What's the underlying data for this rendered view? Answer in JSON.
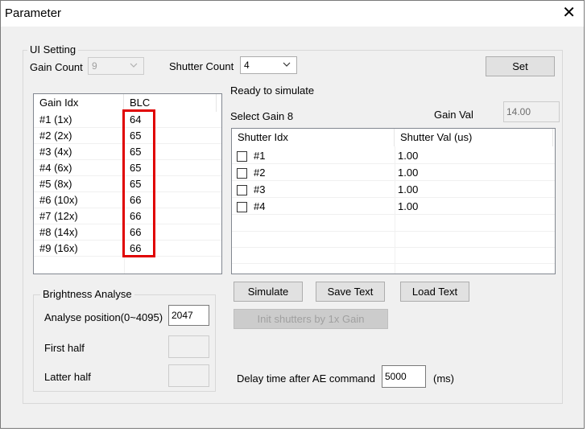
{
  "window": {
    "title": "Parameter"
  },
  "ui_setting": {
    "group_title": "UI Setting",
    "gain_count_label": "Gain Count",
    "gain_count_value": "9",
    "shutter_count_label": "Shutter Count",
    "shutter_count_value": "4",
    "set_label": "Set"
  },
  "status": "Ready to simulate",
  "select_gain": "Select Gain 8",
  "gain_val": {
    "label": "Gain Val",
    "value": "14.00"
  },
  "gain_table": {
    "headers": [
      "Gain Idx",
      "BLC"
    ],
    "rows": [
      {
        "idx": "#1 (1x)",
        "blc": "64"
      },
      {
        "idx": "#2 (2x)",
        "blc": "65"
      },
      {
        "idx": "#3 (4x)",
        "blc": "65"
      },
      {
        "idx": "#4 (6x)",
        "blc": "65"
      },
      {
        "idx": "#5 (8x)",
        "blc": "65"
      },
      {
        "idx": "#6 (10x)",
        "blc": "66"
      },
      {
        "idx": "#7 (12x)",
        "blc": "66"
      },
      {
        "idx": "#8 (14x)",
        "blc": "66"
      },
      {
        "idx": "#9 (16x)",
        "blc": "66"
      }
    ]
  },
  "shutter_table": {
    "headers": [
      "Shutter Idx",
      "Shutter Val (us)"
    ],
    "rows": [
      {
        "idx": "#1",
        "val": "1.00"
      },
      {
        "idx": "#2",
        "val": "1.00"
      },
      {
        "idx": "#3",
        "val": "1.00"
      },
      {
        "idx": "#4",
        "val": "1.00"
      }
    ]
  },
  "buttons": {
    "simulate": "Simulate",
    "save_text": "Save Text",
    "load_text": "Load Text",
    "init_shutters": "Init shutters by 1x Gain"
  },
  "brightness": {
    "group_title": "Brightness Analyse",
    "analyse_label": "Analyse position(0~4095)",
    "analyse_value": "2047",
    "first_half_label": "First half",
    "first_half_value": "",
    "latter_half_label": "Latter half",
    "latter_half_value": ""
  },
  "delay": {
    "label": "Delay time after AE command",
    "value": "5000",
    "unit": "(ms)"
  },
  "colors": {
    "highlight": "#e00000",
    "face": "#f0f0f0"
  }
}
